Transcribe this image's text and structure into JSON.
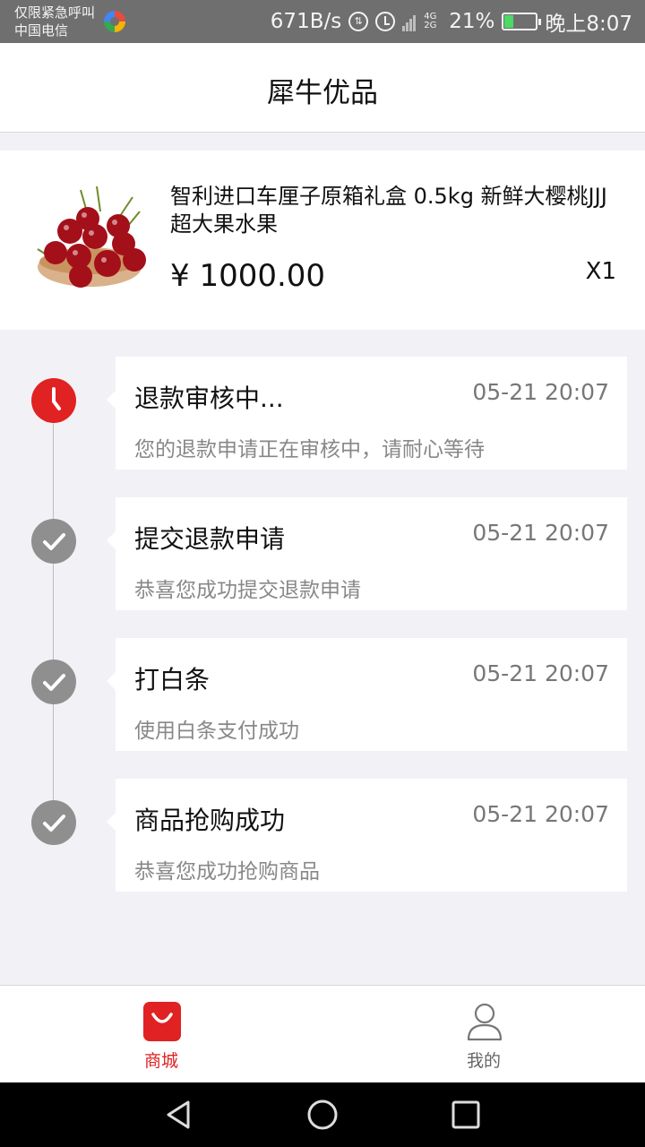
{
  "status_bar": {
    "emergency_text": "仅限紧急呼叫",
    "carrier": "中国电信",
    "net_speed": "671B/s",
    "net_type": "4G 2G",
    "battery": "21%",
    "time": "晚上8:07",
    "icons": [
      "data-saver-icon",
      "alarm-icon",
      "signal-icon",
      "battery-icon"
    ]
  },
  "header": {
    "title": "犀牛优品"
  },
  "product": {
    "image_icon": "cherries-image",
    "name": "智利进口车厘子原箱礼盒 0.5kg 新鲜大樱桃JJJ超大果水果",
    "price": "¥ 1000.00",
    "quantity": "X1"
  },
  "timeline": [
    {
      "title": "退款审核中...",
      "time": "05-21 20:07",
      "desc": "您的退款申请正在审核中，请耐心等待",
      "status": "active",
      "icon": "clock-icon"
    },
    {
      "title": "提交退款申请",
      "time": "05-21 20:07",
      "desc": "恭喜您成功提交退款申请",
      "status": "done",
      "icon": "check-icon"
    },
    {
      "title": "打白条",
      "time": "05-21 20:07",
      "desc": "使用白条支付成功",
      "status": "done",
      "icon": "check-icon"
    },
    {
      "title": "商品抢购成功",
      "time": "05-21 20:07",
      "desc": "恭喜您成功抢购商品",
      "status": "done",
      "icon": "check-icon"
    }
  ],
  "tabs": [
    {
      "label": "商城",
      "icon": "shopping-bag-icon",
      "active": true
    },
    {
      "label": "我的",
      "icon": "user-icon",
      "active": false
    }
  ],
  "colors": {
    "accent": "#e02222",
    "done": "#8f8f8f",
    "background": "#f2f2f6"
  }
}
